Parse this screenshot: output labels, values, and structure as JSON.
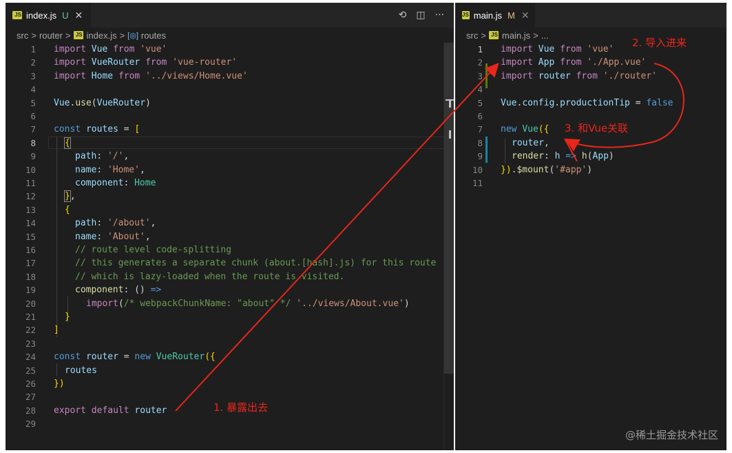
{
  "left": {
    "tab": {
      "filename": "index.js",
      "status": "U",
      "close": "✕",
      "icon": "js-file-icon"
    },
    "actions": {
      "compare": "⟲",
      "split": "◫",
      "more": "···"
    },
    "breadcrumb": {
      "parts": [
        "src",
        "router",
        "index.js",
        "routes"
      ],
      "separator": ">"
    },
    "lines": [
      "1",
      "2",
      "3",
      "4",
      "5",
      "6",
      "7",
      "8",
      "9",
      "10",
      "11",
      "12",
      "13",
      "14",
      "15",
      "16",
      "17",
      "18",
      "19",
      "20",
      "21",
      "22",
      "23",
      "24",
      "25",
      "26",
      "27",
      "28",
      "29"
    ],
    "code": {
      "l1": [
        "import",
        "Vue",
        "from",
        "'vue'"
      ],
      "l2": [
        "import",
        "VueRouter",
        "from",
        "'vue-router'"
      ],
      "l3": [
        "import",
        "Home",
        "from",
        "'../views/Home.vue'"
      ],
      "l5": [
        "Vue",
        ".",
        "use",
        "(",
        "VueRouter",
        ")"
      ],
      "l7": [
        "const",
        "routes",
        "=",
        "["
      ],
      "l8": [
        "{"
      ],
      "l9": [
        "path",
        ":",
        "'/'",
        ","
      ],
      "l10": [
        "name",
        ":",
        "'Home'",
        ","
      ],
      "l11": [
        "component",
        ":",
        "Home"
      ],
      "l12": [
        "}",
        ","
      ],
      "l13": [
        "{"
      ],
      "l14": [
        "path",
        ":",
        "'/about'",
        ","
      ],
      "l15": [
        "name",
        ":",
        "'About'",
        ","
      ],
      "l16": "// route level code-splitting",
      "l17": "// this generates a separate chunk (about.[hash].js) for this route",
      "l18": "// which is lazy-loaded when the route is visited.",
      "l19": [
        "component",
        ":",
        "()",
        "=>"
      ],
      "l20": [
        "import",
        "(",
        "/* webpackChunkName: \"about\" */",
        "'../views/About.vue'",
        ")"
      ],
      "l21": [
        "}"
      ],
      "l22": [
        "]"
      ],
      "l24": [
        "const",
        "router",
        "=",
        "new",
        "VueRouter",
        "({"
      ],
      "l25": [
        "routes"
      ],
      "l26": [
        "})"
      ],
      "l28": [
        "export",
        "default",
        "router"
      ]
    }
  },
  "right": {
    "tab": {
      "filename": "main.js",
      "status": "M",
      "close": "✕",
      "icon": "js-file-icon"
    },
    "breadcrumb": {
      "parts": [
        "src",
        "main.js",
        "..."
      ],
      "separator": ">"
    },
    "lines": [
      "1",
      "2",
      "3",
      "4",
      "5",
      "6",
      "7",
      "8",
      "9",
      "10",
      "11"
    ],
    "code": {
      "l1": [
        "import",
        "Vue",
        "from",
        "'vue'"
      ],
      "l2": [
        "import",
        "App",
        "from",
        "'./App.vue'"
      ],
      "l3": [
        "import",
        "router",
        "from",
        "'./router'"
      ],
      "l5": [
        "Vue",
        ".",
        "config",
        ".",
        "productionTip",
        "=",
        "false"
      ],
      "l7": [
        "new",
        "Vue",
        "({"
      ],
      "l8": [
        "router",
        ","
      ],
      "l9": [
        "render",
        ":",
        "h",
        "=>",
        "h",
        "(",
        "App",
        ")"
      ],
      "l10": [
        "})",
        ".",
        "$mount",
        "(",
        "'#app'",
        ")"
      ]
    }
  },
  "annotations": {
    "a1": "1. 暴露出去",
    "a2": "2. 导入进来",
    "a3": "3. 和Vue关联"
  },
  "watermark": "@稀土掘金技术社区",
  "colors": {
    "annotation": "#e8261b",
    "editor_bg": "#1e1e1e",
    "keyword": "#c586c0",
    "string": "#ce9178",
    "comment": "#6a9955"
  }
}
